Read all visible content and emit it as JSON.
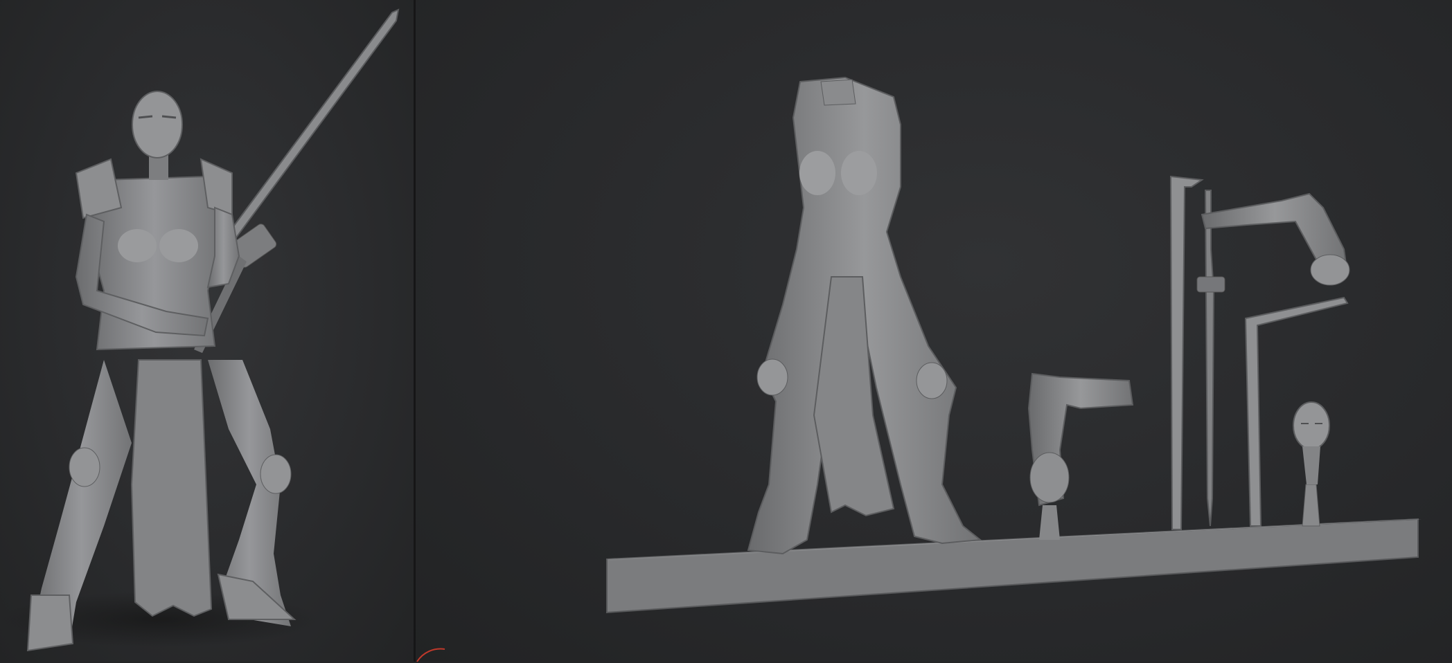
{
  "viewports": [
    {
      "id": "left",
      "content": "posed-figure-with-sword"
    },
    {
      "id": "right",
      "content": "model-parts-on-base"
    }
  ],
  "colors": {
    "background": "#242526",
    "clay": "#8e8f91",
    "clay_shadow": "#5e5f61",
    "clay_highlight": "#b4b5b7",
    "divider": "#161617",
    "gizmo": "#c0392b"
  },
  "icons": [
    "orientation-gizmo-icon"
  ]
}
